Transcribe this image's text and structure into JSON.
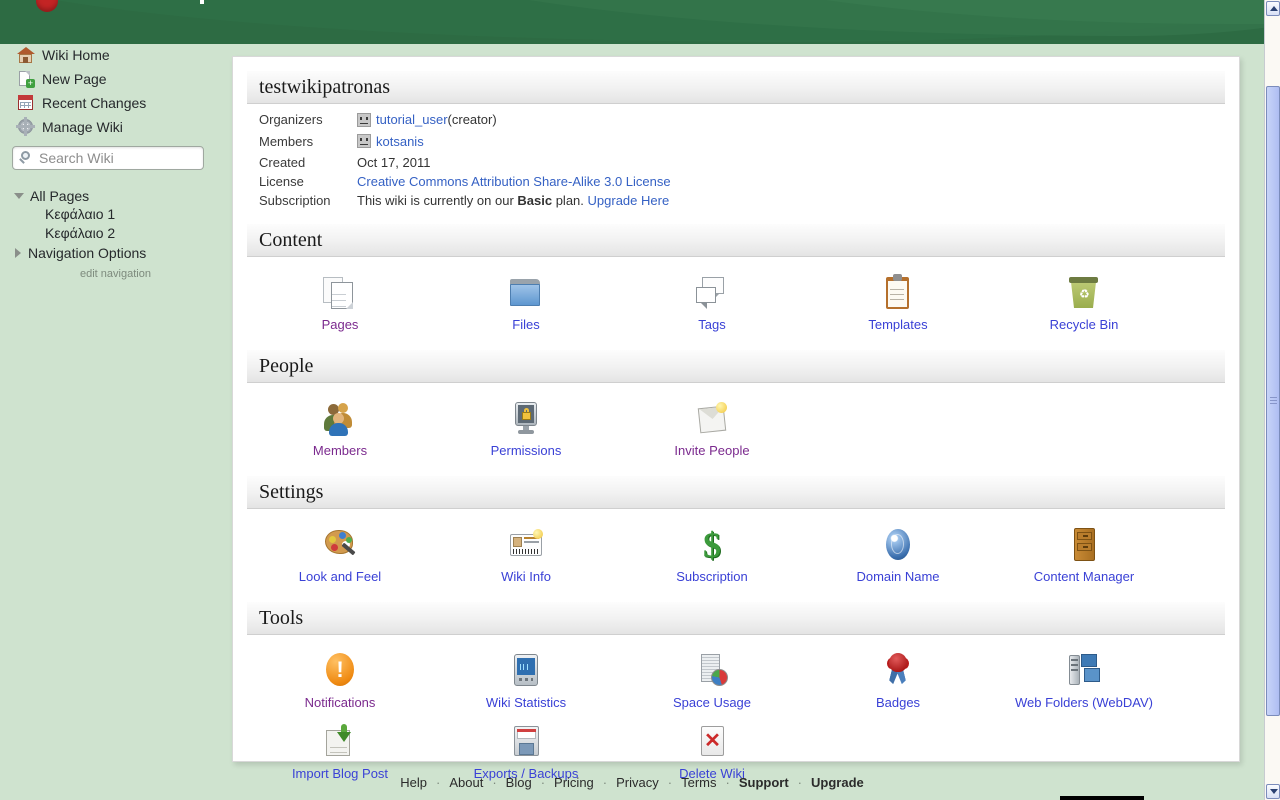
{
  "sidebar": {
    "nav": [
      {
        "label": "Wiki Home",
        "icon": "home-icon"
      },
      {
        "label": "New Page",
        "icon": "new-page-icon"
      },
      {
        "label": "Recent Changes",
        "icon": "calendar-icon"
      },
      {
        "label": "Manage Wiki",
        "icon": "gear-icon"
      }
    ],
    "search": {
      "placeholder": "Search Wiki",
      "value": ""
    },
    "tree": {
      "root": "All Pages",
      "children": [
        "Κεφάλαιο 1",
        "Κεφάλαιο 2"
      ],
      "nav_options": "Navigation Options",
      "edit_link": "edit navigation"
    }
  },
  "wiki": {
    "title": "testwikipatronas",
    "info": {
      "organizers_label": "Organizers",
      "organizers_user": "tutorial_user",
      "organizers_suffix": " (creator)",
      "members_label": "Members",
      "members_user": "kotsanis",
      "created_label": "Created",
      "created_value": "Oct 17, 2011",
      "license_label": "License",
      "license_value": "Creative Commons Attribution Share-Alike 3.0 License",
      "subscription_label": "Subscription",
      "subscription_pre": "This wiki is currently on our ",
      "subscription_plan": "Basic",
      "subscription_post": " plan. ",
      "subscription_link": "Upgrade Here"
    }
  },
  "sections": [
    {
      "title": "Content",
      "tiles": [
        {
          "label": "Pages",
          "icon": "pages-icon",
          "visited": true
        },
        {
          "label": "Files",
          "icon": "folder-icon",
          "visited": false
        },
        {
          "label": "Tags",
          "icon": "tags-icon",
          "visited": false
        },
        {
          "label": "Templates",
          "icon": "clipboard-icon",
          "visited": false
        },
        {
          "label": "Recycle Bin",
          "icon": "recycle-bin-icon",
          "visited": false
        }
      ]
    },
    {
      "title": "People",
      "tiles": [
        {
          "label": "Members",
          "icon": "members-icon",
          "visited": true
        },
        {
          "label": "Permissions",
          "icon": "lock-monitor-icon",
          "visited": false
        },
        {
          "label": "Invite People",
          "icon": "envelope-icon",
          "visited": true
        }
      ]
    },
    {
      "title": "Settings",
      "tiles": [
        {
          "label": "Look and Feel",
          "icon": "palette-icon",
          "visited": false
        },
        {
          "label": "Wiki Info",
          "icon": "id-card-icon",
          "visited": false
        },
        {
          "label": "Subscription",
          "icon": "dollar-icon",
          "visited": false
        },
        {
          "label": "Domain Name",
          "icon": "globe-icon",
          "visited": false
        },
        {
          "label": "Content Manager",
          "icon": "cabinet-icon",
          "visited": false
        }
      ]
    },
    {
      "title": "Tools",
      "tiles": [
        {
          "label": "Notifications",
          "icon": "alert-icon",
          "visited": true
        },
        {
          "label": "Wiki Statistics",
          "icon": "stats-icon",
          "visited": false
        },
        {
          "label": "Space Usage",
          "icon": "space-usage-icon",
          "visited": false
        },
        {
          "label": "Badges",
          "icon": "rosette-icon",
          "visited": false
        },
        {
          "label": "Web Folders (WebDAV)",
          "icon": "webdav-icon",
          "visited": false
        },
        {
          "label": "Import Blog Post",
          "icon": "import-icon",
          "visited": false
        },
        {
          "label": "Exports / Backups",
          "icon": "floppy-icon",
          "visited": false
        },
        {
          "label": "Delete Wiki",
          "icon": "delete-icon",
          "visited": false
        }
      ]
    }
  ],
  "footer": {
    "links": [
      {
        "label": "Help",
        "bold": false
      },
      {
        "label": "About",
        "bold": false
      },
      {
        "label": "Blog",
        "bold": false
      },
      {
        "label": "Pricing",
        "bold": false
      },
      {
        "label": "Privacy",
        "bold": false
      },
      {
        "label": "Terms",
        "bold": false
      },
      {
        "label": "Support",
        "bold": true
      },
      {
        "label": "Upgrade",
        "bold": true
      }
    ],
    "separator": "·"
  },
  "colors": {
    "banner_green": "#2d6b43",
    "page_green": "#cfe3cf",
    "link_blue": "#3a41d6",
    "link_visited": "#7b2a8e",
    "info_link": "#3561c4"
  }
}
